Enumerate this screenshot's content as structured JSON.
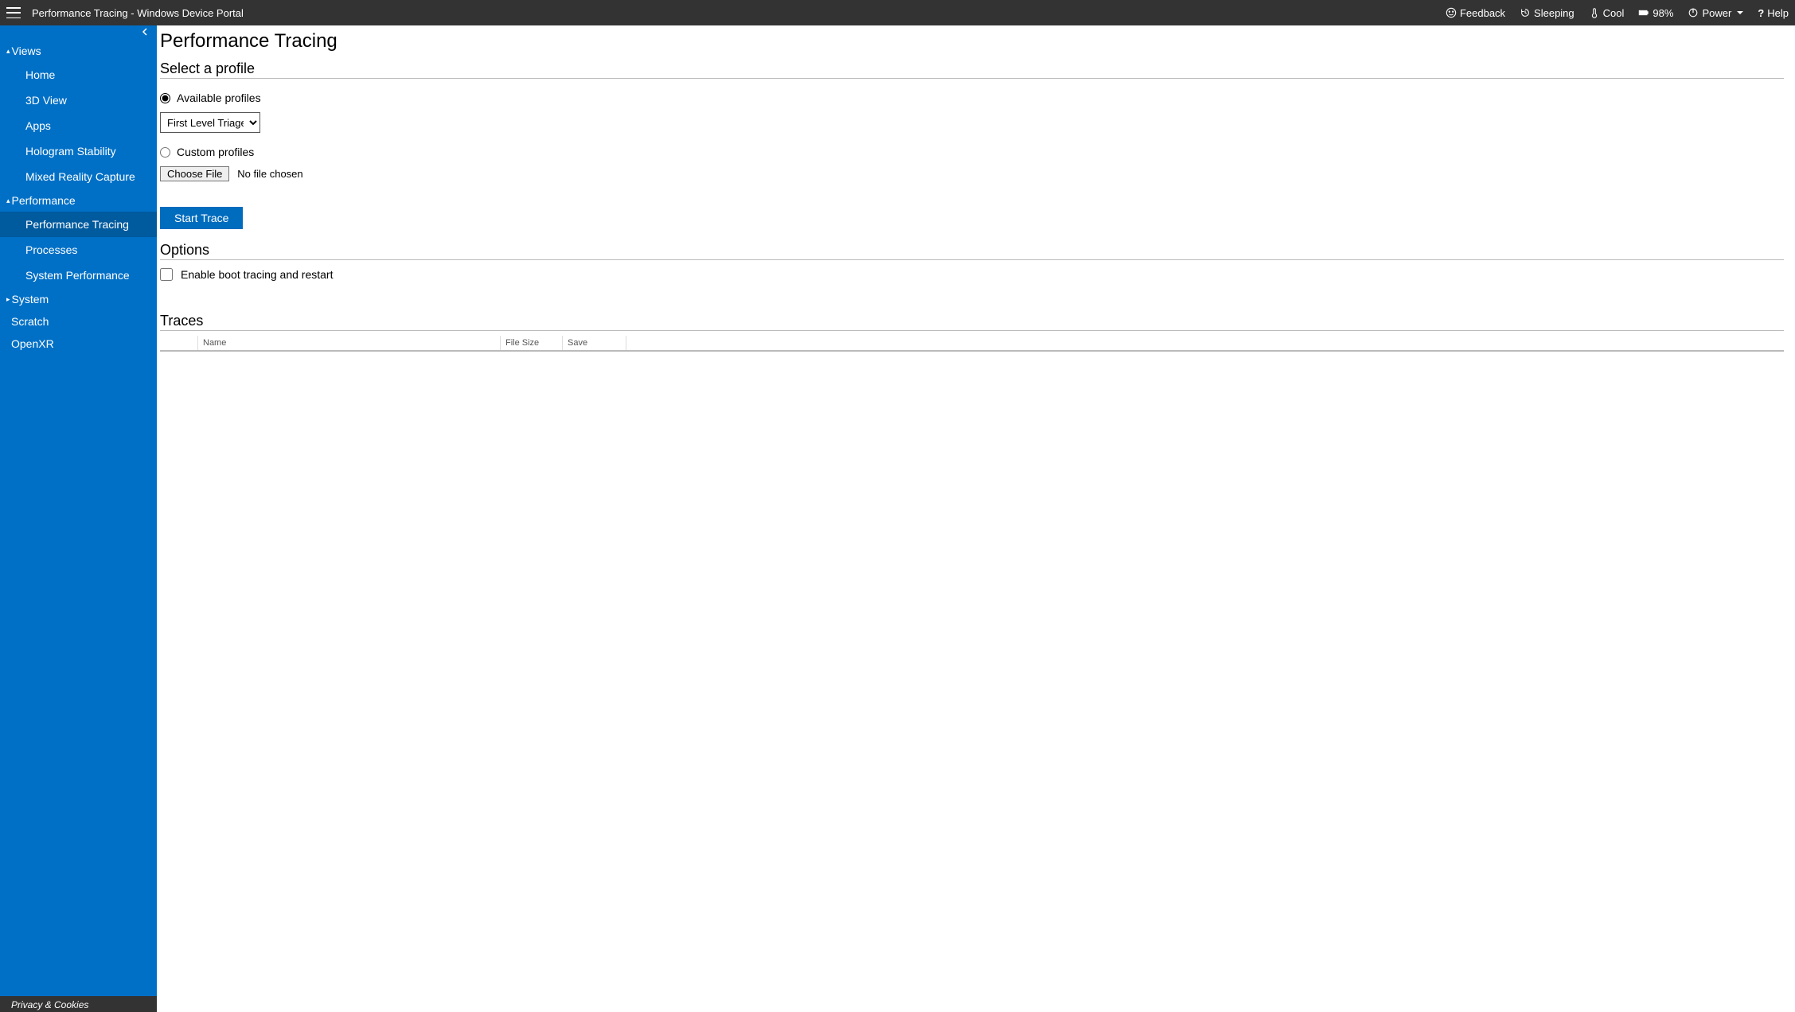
{
  "header": {
    "title": "Performance Tracing - Windows Device Portal",
    "feedback": "Feedback",
    "sleeping": "Sleeping",
    "cool": "Cool",
    "battery": "98%",
    "power": "Power",
    "help": "Help"
  },
  "sidebar": {
    "sections": {
      "views": {
        "label": "Views",
        "expanded": true
      },
      "performance": {
        "label": "Performance",
        "expanded": true
      },
      "system": {
        "label": "System",
        "expanded": false
      }
    },
    "views_items": [
      "Home",
      "3D View",
      "Apps",
      "Hologram Stability",
      "Mixed Reality Capture"
    ],
    "performance_items": [
      "Performance Tracing",
      "Processes",
      "System Performance"
    ],
    "top_items": [
      "Scratch",
      "OpenXR"
    ],
    "active": "Performance Tracing",
    "footer": "Privacy & Cookies"
  },
  "page": {
    "title": "Performance Tracing",
    "select_profile_heading": "Select a profile",
    "available_profiles_label": "Available profiles",
    "custom_profiles_label": "Custom profiles",
    "profile_selected": "First Level Triage",
    "choose_file_label": "Choose File",
    "no_file_label": "No file chosen",
    "start_trace_label": "Start Trace",
    "options_heading": "Options",
    "enable_boot_label": "Enable boot tracing and restart",
    "traces_heading": "Traces",
    "traces_columns": {
      "name": "Name",
      "size": "File Size",
      "save": "Save"
    }
  }
}
